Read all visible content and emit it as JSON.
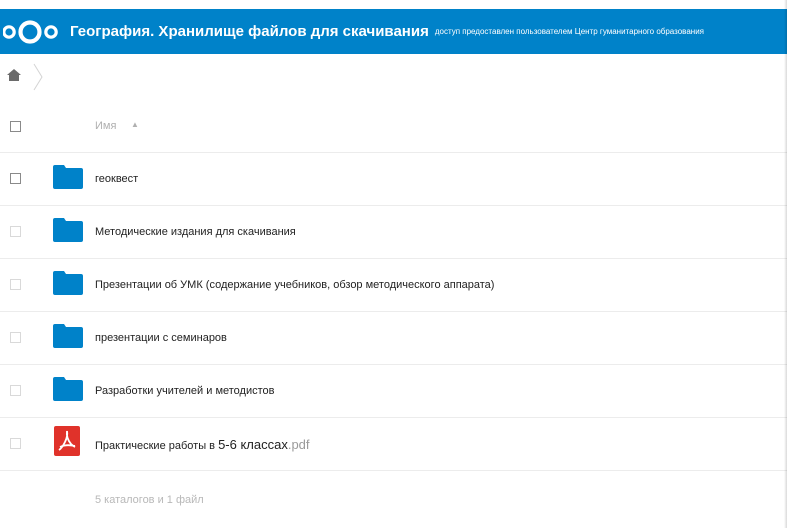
{
  "header": {
    "title": "География. Хранилище файлов для скачивания",
    "subtitle": "доступ предоставлен пользователем Центр гуманитарного образования",
    "background": "#0082c9"
  },
  "breadcrumb": {
    "home_icon": "home-icon"
  },
  "list": {
    "column_name": "Имя",
    "sort_indicator": "▲",
    "items": [
      {
        "name": "геоквест",
        "type": "folder"
      },
      {
        "name": "Методические издания для скачивания",
        "type": "folder"
      },
      {
        "name": "Презентации об УМК (содержание учебников, обзор методического аппарата)",
        "type": "folder"
      },
      {
        "name": "презентации с семинаров",
        "type": "folder"
      },
      {
        "name": "Разработки учителей и методистов",
        "type": "folder"
      },
      {
        "name_prefix": "Практические работы в ",
        "name_big": "5-6 классах",
        "ext": ".pdf",
        "type": "pdf"
      }
    ],
    "summary": "5 каталогов и 1 файл"
  },
  "colors": {
    "folder": "#0082c9",
    "pdf": "#e0322a"
  }
}
